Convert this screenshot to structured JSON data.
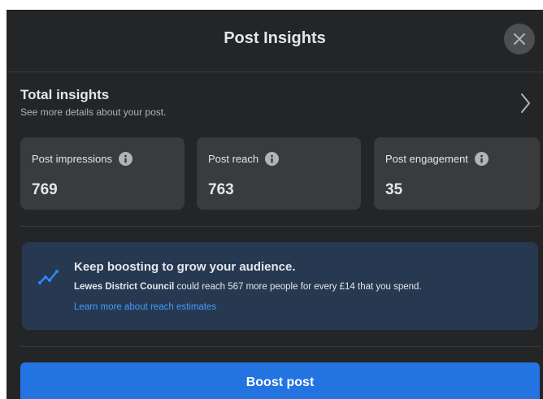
{
  "dialog": {
    "title": "Post Insights"
  },
  "total_insights": {
    "title": "Total insights",
    "subtitle": "See more details about your post."
  },
  "metrics": [
    {
      "label": "Post impressions",
      "value": "769"
    },
    {
      "label": "Post reach",
      "value": "763"
    },
    {
      "label": "Post engagement",
      "value": "35"
    }
  ],
  "boost_banner": {
    "title": "Keep boosting to grow your audience.",
    "page_name": "Lewes District Council",
    "message": " could reach 567 more people for every £14 that you spend.",
    "link_text": "Learn more about reach estimates"
  },
  "boost_button": {
    "label": "Boost post"
  },
  "icons": {
    "close": "close-icon",
    "chevron": "chevron-right-icon",
    "info": "info-icon",
    "trend": "trend-up-icon"
  },
  "colors": {
    "background": "#242526",
    "card": "#3a3b3c",
    "banner": "#263951",
    "accent": "#2374e1",
    "link": "#4599ff"
  }
}
